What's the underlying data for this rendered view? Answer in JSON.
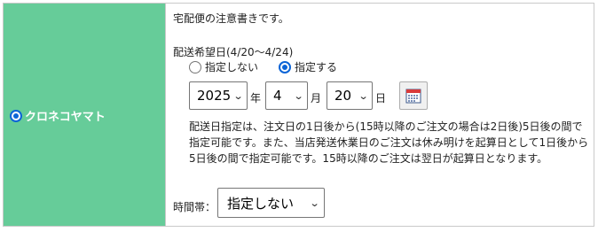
{
  "carrier": {
    "label": "クロネコヤマト",
    "selected": true
  },
  "delivery": {
    "note": "宅配便の注意書きです。",
    "date_label": "配送希望日(4/20～4/24)",
    "options": [
      {
        "label": "指定しない",
        "selected": false
      },
      {
        "label": "指定する",
        "selected": true
      }
    ],
    "year": {
      "value": "2025",
      "unit": "年"
    },
    "month": {
      "value": "4",
      "unit": "月"
    },
    "day": {
      "value": "20",
      "unit": "日"
    },
    "calendar_icon": "calendar-icon",
    "description": [
      "配送日指定は、注文日の1日後から(15時以降のご注文の場合は2日後)5日後の間で",
      "指定可能です。また、当店発送休業日のご注文は休み明けを起算日として1日後から",
      "5日後の間で指定可能です。15時以降のご注文は翌日が起算日となります。"
    ],
    "time_label": "時間帯：",
    "time_value": "指定しない"
  },
  "colors": {
    "carrier_bg": "#66cc99",
    "radio_accent": "#0b64d6",
    "border": "#c9c9c9"
  }
}
